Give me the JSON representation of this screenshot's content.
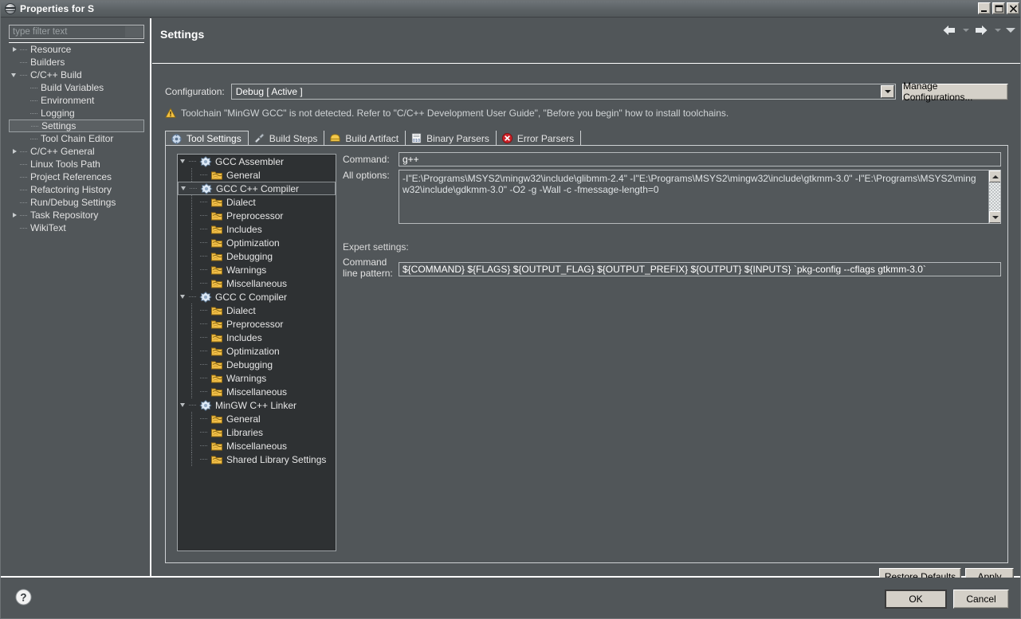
{
  "window": {
    "title": "Properties for S",
    "icon": "properties-window-icon",
    "controls": [
      {
        "name": "minimize-button",
        "glyph": "minimize"
      },
      {
        "name": "maximize-button",
        "glyph": "maximize"
      },
      {
        "name": "close-button",
        "glyph": "close"
      }
    ]
  },
  "left_pane": {
    "filter": {
      "placeholder": "type filter text",
      "value": ""
    },
    "tree": [
      {
        "label": "Resource",
        "indent": 0,
        "twisty": "closed",
        "selected": false
      },
      {
        "label": "Builders",
        "indent": 0,
        "twisty": "none",
        "selected": false
      },
      {
        "label": "C/C++ Build",
        "indent": 0,
        "twisty": "open",
        "selected": false
      },
      {
        "label": "Build Variables",
        "indent": 1,
        "twisty": "none",
        "selected": false
      },
      {
        "label": "Environment",
        "indent": 1,
        "twisty": "none",
        "selected": false
      },
      {
        "label": "Logging",
        "indent": 1,
        "twisty": "none",
        "selected": false
      },
      {
        "label": "Settings",
        "indent": 1,
        "twisty": "none",
        "selected": true
      },
      {
        "label": "Tool Chain Editor",
        "indent": 1,
        "twisty": "none",
        "selected": false
      },
      {
        "label": "C/C++ General",
        "indent": 0,
        "twisty": "closed",
        "selected": false
      },
      {
        "label": "Linux Tools Path",
        "indent": 0,
        "twisty": "none",
        "selected": false
      },
      {
        "label": "Project References",
        "indent": 0,
        "twisty": "none",
        "selected": false
      },
      {
        "label": "Refactoring History",
        "indent": 0,
        "twisty": "none",
        "selected": false
      },
      {
        "label": "Run/Debug Settings",
        "indent": 0,
        "twisty": "none",
        "selected": false
      },
      {
        "label": "Task Repository",
        "indent": 0,
        "twisty": "closed",
        "selected": false
      },
      {
        "label": "WikiText",
        "indent": 0,
        "twisty": "none",
        "selected": false
      }
    ]
  },
  "right_pane": {
    "title": "Settings",
    "nav": {
      "back": "back-arrow",
      "forward": "forward-arrow",
      "menu": "view-menu-caret"
    },
    "configuration": {
      "label": "Configuration:",
      "value": "Debug  [ Active ]",
      "manage_button": "Manage Configurations..."
    },
    "warning": {
      "icon": "warning-triangle-icon",
      "text": "Toolchain \"MinGW GCC\" is not detected. Refer to \"C/C++ Development User Guide\", \"Before you begin\" how to install toolchains."
    },
    "tabs": [
      {
        "label": "Tool Settings",
        "icon": "tool-settings-icon",
        "active": true
      },
      {
        "label": "Build Steps",
        "icon": "build-steps-icon",
        "active": false
      },
      {
        "label": "Build Artifact",
        "icon": "build-artifact-icon",
        "active": false
      },
      {
        "label": "Binary Parsers",
        "icon": "binary-parsers-icon",
        "active": false
      },
      {
        "label": "Error Parsers",
        "icon": "error-parsers-icon",
        "active": false
      }
    ],
    "tool_tree": [
      {
        "label": "GCC Assembler",
        "indent": 0,
        "twisty": "open",
        "icon": "tool-icon",
        "selected": false
      },
      {
        "label": "General",
        "indent": 1,
        "twisty": "none",
        "icon": "folder-icon",
        "selected": false
      },
      {
        "label": "GCC C++ Compiler",
        "indent": 0,
        "twisty": "open",
        "icon": "tool-icon",
        "selected": true
      },
      {
        "label": "Dialect",
        "indent": 1,
        "twisty": "none",
        "icon": "folder-icon",
        "selected": false
      },
      {
        "label": "Preprocessor",
        "indent": 1,
        "twisty": "none",
        "icon": "folder-icon",
        "selected": false
      },
      {
        "label": "Includes",
        "indent": 1,
        "twisty": "none",
        "icon": "folder-icon",
        "selected": false
      },
      {
        "label": "Optimization",
        "indent": 1,
        "twisty": "none",
        "icon": "folder-icon",
        "selected": false
      },
      {
        "label": "Debugging",
        "indent": 1,
        "twisty": "none",
        "icon": "folder-icon",
        "selected": false
      },
      {
        "label": "Warnings",
        "indent": 1,
        "twisty": "none",
        "icon": "folder-icon",
        "selected": false
      },
      {
        "label": "Miscellaneous",
        "indent": 1,
        "twisty": "none",
        "icon": "folder-icon",
        "selected": false
      },
      {
        "label": "GCC C Compiler",
        "indent": 0,
        "twisty": "open",
        "icon": "tool-icon",
        "selected": false
      },
      {
        "label": "Dialect",
        "indent": 1,
        "twisty": "none",
        "icon": "folder-icon",
        "selected": false
      },
      {
        "label": "Preprocessor",
        "indent": 1,
        "twisty": "none",
        "icon": "folder-icon",
        "selected": false
      },
      {
        "label": "Includes",
        "indent": 1,
        "twisty": "none",
        "icon": "folder-icon",
        "selected": false
      },
      {
        "label": "Optimization",
        "indent": 1,
        "twisty": "none",
        "icon": "folder-icon",
        "selected": false
      },
      {
        "label": "Debugging",
        "indent": 1,
        "twisty": "none",
        "icon": "folder-icon",
        "selected": false
      },
      {
        "label": "Warnings",
        "indent": 1,
        "twisty": "none",
        "icon": "folder-icon",
        "selected": false
      },
      {
        "label": "Miscellaneous",
        "indent": 1,
        "twisty": "none",
        "icon": "folder-icon",
        "selected": false
      },
      {
        "label": "MinGW C++ Linker",
        "indent": 0,
        "twisty": "open",
        "icon": "tool-icon",
        "selected": false
      },
      {
        "label": "General",
        "indent": 1,
        "twisty": "none",
        "icon": "folder-icon",
        "selected": false
      },
      {
        "label": "Libraries",
        "indent": 1,
        "twisty": "none",
        "icon": "folder-icon",
        "selected": false
      },
      {
        "label": "Miscellaneous",
        "indent": 1,
        "twisty": "none",
        "icon": "folder-icon",
        "selected": false
      },
      {
        "label": "Shared Library Settings",
        "indent": 1,
        "twisty": "none",
        "icon": "folder-icon",
        "selected": false
      }
    ],
    "form": {
      "command_label": "Command:",
      "command_value": "g++",
      "all_options_label": "All options:",
      "all_options_value": "-I\"E:\\Programs\\MSYS2\\mingw32\\include\\glibmm-2.4\" -I\"E:\\Programs\\MSYS2\\mingw32\\include\\gtkmm-3.0\" -I\"E:\\Programs\\MSYS2\\mingw32\\include\\gdkmm-3.0\" -O2 -g -Wall -c -fmessage-length=0",
      "expert_settings_label": "Expert settings:",
      "command_line_pattern_label": "Command\nline pattern:",
      "command_line_pattern_value": "${COMMAND} ${FLAGS} ${OUTPUT_FLAG} ${OUTPUT_PREFIX} ${OUTPUT} ${INPUTS} `pkg-config --cflags gtkmm-3.0`"
    },
    "restore_defaults_button": "Restore Defaults",
    "apply_button": "Apply"
  },
  "bottom_bar": {
    "help_icon": "help-question-icon",
    "ok_button": "OK",
    "cancel_button": "Cancel"
  },
  "colors": {
    "background": "#515659",
    "tree_background": "#2e3133",
    "border": "#cfd2d4",
    "button_face": "#d4d0c8",
    "title_text": "#ffffff",
    "warning_yellow": "#f5c242",
    "error_red": "#cc2229"
  }
}
